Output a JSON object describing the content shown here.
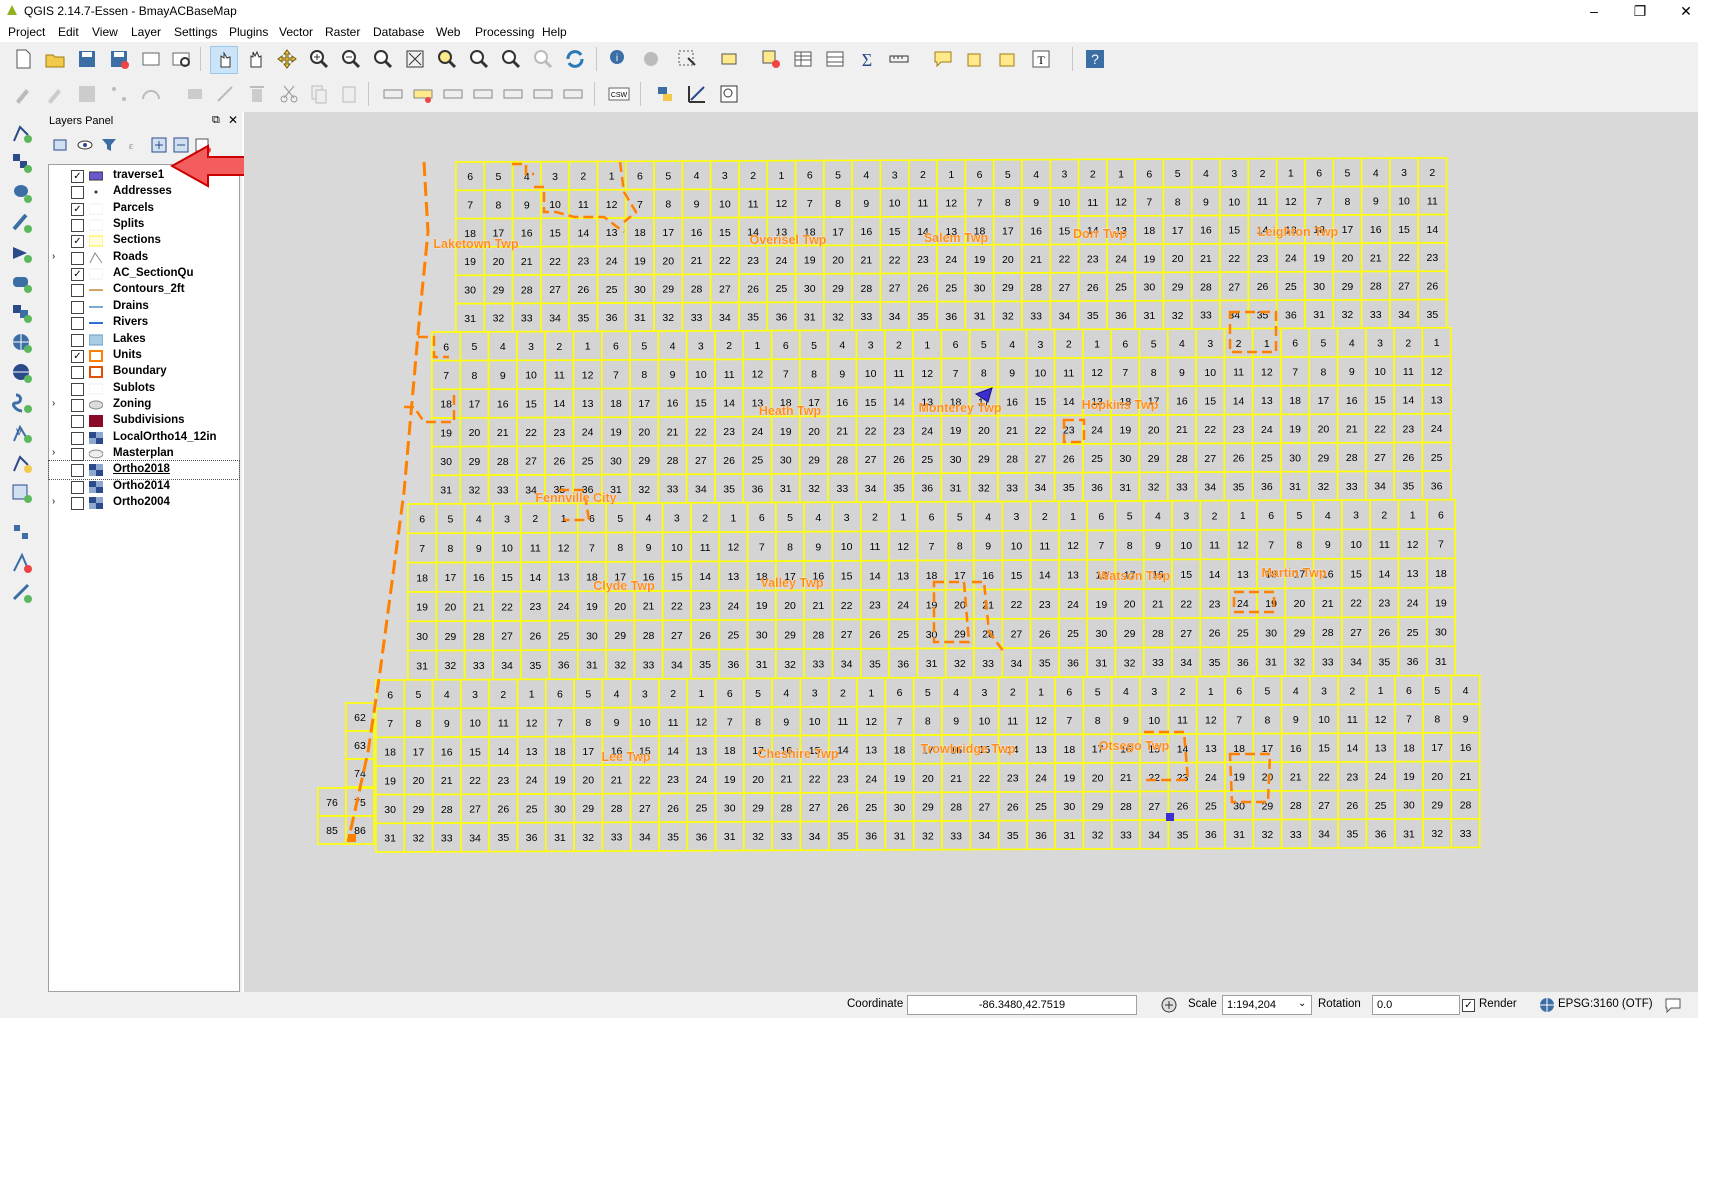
{
  "window": {
    "title": "QGIS 2.14.7-Essen - BmayACBaseMap",
    "minimize": "–",
    "restore": "❐",
    "close": "✕"
  },
  "menu": [
    "Project",
    "Edit",
    "View",
    "Layer",
    "Settings",
    "Plugins",
    "Vector",
    "Raster",
    "Database",
    "Web",
    "Processing",
    "Help"
  ],
  "layers_panel": {
    "title": "Layers Panel",
    "layers": [
      {
        "name": "traverse1",
        "checked": true,
        "symbol": "traverse",
        "expandable": false,
        "underline": false
      },
      {
        "name": "Addresses",
        "checked": false,
        "symbol": "point",
        "expandable": false,
        "underline": false
      },
      {
        "name": "Parcels",
        "checked": true,
        "symbol": "blank",
        "expandable": false,
        "underline": false
      },
      {
        "name": "Splits",
        "checked": false,
        "symbol": "blank",
        "expandable": false,
        "underline": false
      },
      {
        "name": "Sections",
        "checked": true,
        "symbol": "yellow",
        "expandable": false,
        "underline": false
      },
      {
        "name": "Roads",
        "checked": false,
        "symbol": "roads",
        "expandable": true,
        "underline": false
      },
      {
        "name": "AC_SectionQu",
        "checked": true,
        "symbol": "blank",
        "expandable": false,
        "underline": false
      },
      {
        "name": "Contours_2ft",
        "checked": false,
        "symbol": "contour",
        "expandable": false,
        "underline": false
      },
      {
        "name": "Drains",
        "checked": false,
        "symbol": "drain",
        "expandable": false,
        "underline": false
      },
      {
        "name": "Rivers",
        "checked": false,
        "symbol": "river",
        "expandable": false,
        "underline": false
      },
      {
        "name": "Lakes",
        "checked": false,
        "symbol": "lake",
        "expandable": false,
        "underline": false
      },
      {
        "name": "Units",
        "checked": true,
        "symbol": "units",
        "expandable": false,
        "underline": false
      },
      {
        "name": "Boundary",
        "checked": false,
        "symbol": "boundary",
        "expandable": false,
        "underline": false
      },
      {
        "name": "Sublots",
        "checked": false,
        "symbol": "blank",
        "expandable": false,
        "underline": false
      },
      {
        "name": "Zoning",
        "checked": false,
        "symbol": "zoning",
        "expandable": true,
        "underline": false
      },
      {
        "name": "Subdivisions",
        "checked": false,
        "symbol": "subdiv",
        "expandable": false,
        "underline": false
      },
      {
        "name": "LocalOrtho14_12in",
        "checked": false,
        "symbol": "raster",
        "expandable": false,
        "underline": false
      },
      {
        "name": "Masterplan",
        "checked": false,
        "symbol": "master",
        "expandable": true,
        "underline": false
      },
      {
        "name": "Ortho2018",
        "checked": false,
        "symbol": "raster",
        "expandable": false,
        "underline": true
      },
      {
        "name": "Ortho2014",
        "checked": false,
        "symbol": "raster",
        "expandable": false,
        "underline": false
      },
      {
        "name": "Ortho2004",
        "checked": false,
        "symbol": "raster",
        "expandable": true,
        "underline": false
      }
    ]
  },
  "map": {
    "section_numbers": [
      [
        6,
        5,
        4,
        3,
        2,
        1
      ],
      [
        7,
        8,
        9,
        10,
        11,
        12
      ],
      [
        18,
        17,
        16,
        15,
        14,
        13
      ],
      [
        19,
        20,
        21,
        22,
        23,
        24
      ],
      [
        30,
        29,
        28,
        27,
        26,
        25
      ],
      [
        31,
        32,
        33,
        34,
        35,
        36
      ]
    ],
    "extra_numbers": [
      "62",
      "63",
      "74",
      "76",
      "75",
      "85",
      "86"
    ],
    "townships": [
      [
        "Laketown Twp",
        "Overisel Twp",
        "Salem Twp",
        "Dorr Twp",
        "Leighton Twp"
      ],
      [
        "Fennville City",
        "Heath Twp",
        "Monterey Twp",
        "Hopkins Twp"
      ],
      [
        "Clyde Twp",
        "Valley Twp",
        "Watson Twp",
        "Martin Twp"
      ],
      [
        "Lee Twp",
        "Cheshire Twp",
        "Trowbridge Twp",
        "Otsego Twp"
      ]
    ],
    "colors": {
      "canvas": "#d9d9d9",
      "section_fill": "#d4d4d4",
      "section_line": "#ffff00",
      "label": "#ff8c1a",
      "boundary": "#ff8000",
      "traverse": "#3b2fcf"
    }
  },
  "statusbar": {
    "coordinate_label": "Coordinate",
    "coordinate_value": "-86.3480,42.7519",
    "scale_label": "Scale",
    "scale_value": "1:194,204",
    "rotation_label": "Rotation",
    "rotation_value": "0.0",
    "render_label": "Render",
    "crs": "EPSG:3160 (OTF)"
  }
}
